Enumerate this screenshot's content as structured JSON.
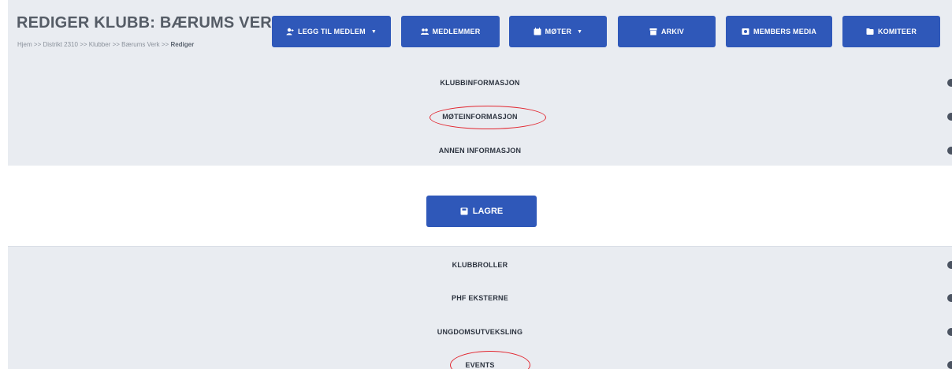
{
  "header": {
    "title": "REDIGER KLUBB: BÆRUMS VERK",
    "breadcrumb": [
      "Hjem",
      "Distrikt 2310",
      "Klubber",
      "Bærums Verk",
      "Rediger"
    ],
    "breadcrumb_sep": ">>"
  },
  "nav": {
    "add_member": "LEGG TIL MEDLEM",
    "members": "MEDLEMMER",
    "meetings": "MØTER",
    "archive": "ARKIV",
    "members_media": "MEMBERS MEDIA",
    "committees": "KOMITEER"
  },
  "sections_top": [
    "KLUBBINFORMASJON",
    "MØTEINFORMASJON",
    "ANNEN INFORMASJON"
  ],
  "save_label": "LAGRE",
  "sections_bottom": [
    "KLUBBROLLER",
    "PHF EKSTERNE",
    "UNGDOMSUTVEKSLING",
    "EVENTS"
  ],
  "colors": {
    "primary": "#2f58b9",
    "panel": "#e9ecf1",
    "annotation": "#e2262f"
  }
}
